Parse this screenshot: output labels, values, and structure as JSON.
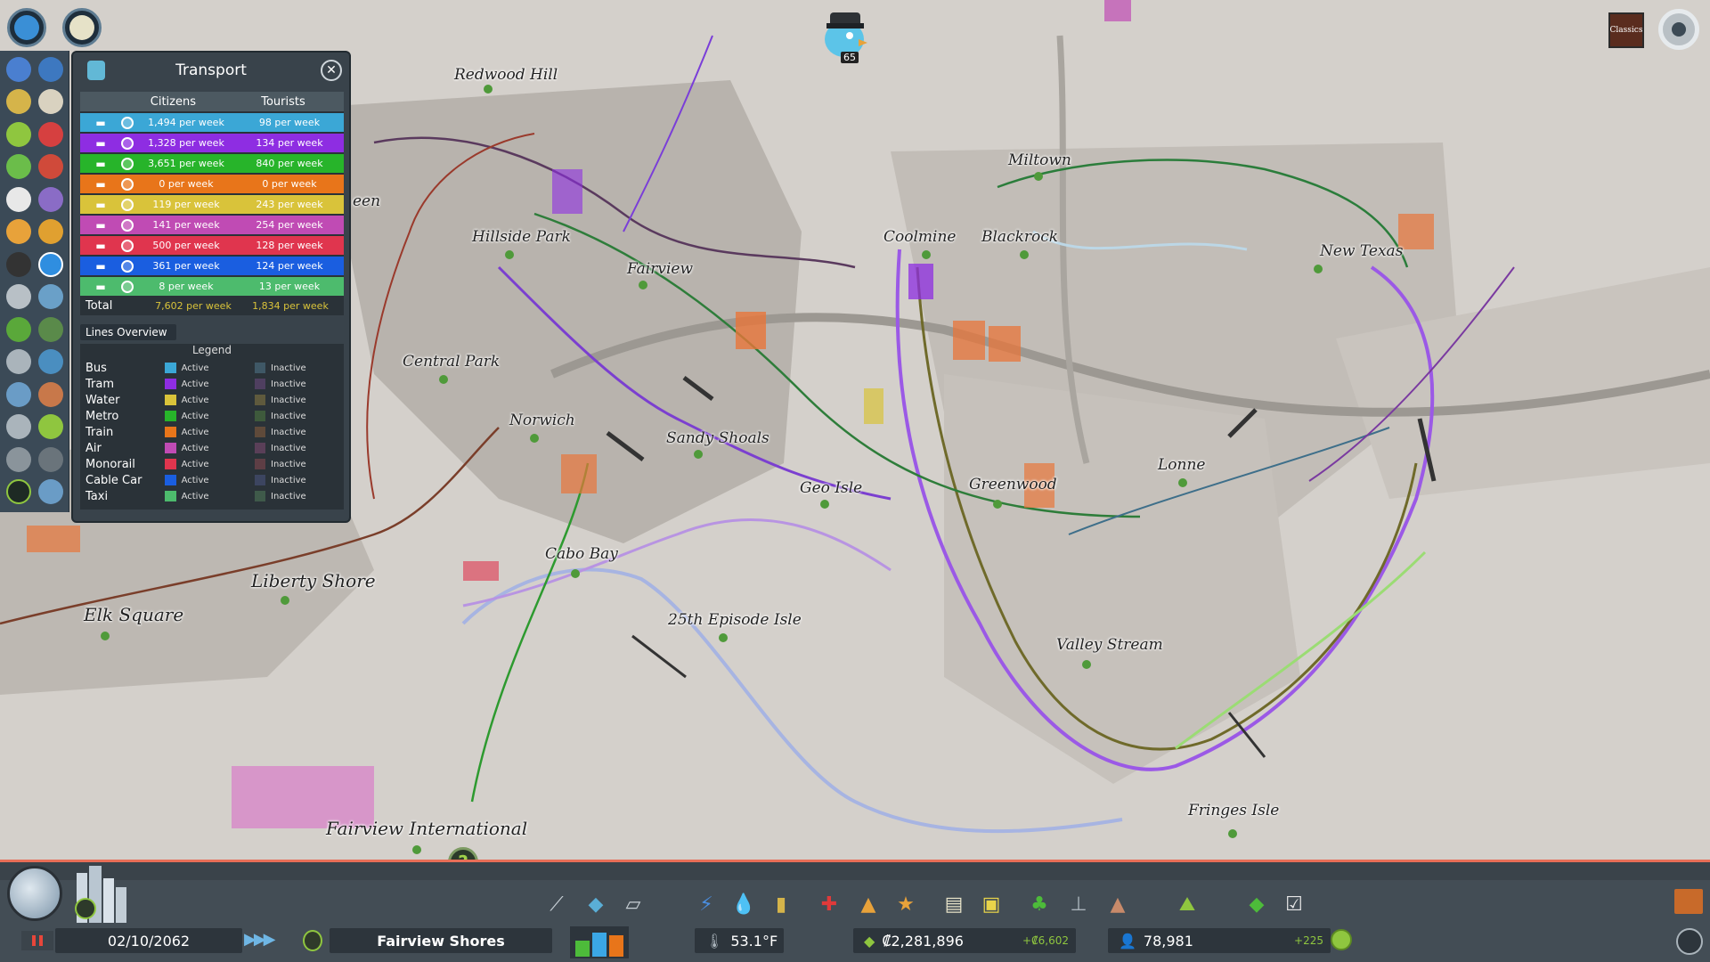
{
  "colors": {
    "bus": "#3ba7d6",
    "tram": "#8e2de2",
    "water": "#d9c33a",
    "metro": "#27b42a",
    "train": "#e8751a",
    "air": "#c04bb4",
    "monorail": "#e0354e",
    "cablecar": "#1a5ee0",
    "taxi": "#4dbb6d"
  },
  "top_buttons": {
    "left_icon": "compass-button-icon",
    "right_icon": "unlock-icon"
  },
  "chirper": {
    "count": "65"
  },
  "radio": {
    "label": "Classics"
  },
  "transport_panel": {
    "title": "Transport",
    "col_citizens": "Citizens",
    "col_tourists": "Tourists",
    "rows": [
      {
        "mode": "bus",
        "icon": "bus-icon",
        "citizens": "1,494 per week",
        "tourists": "98 per week"
      },
      {
        "mode": "tram",
        "icon": "tram-icon",
        "citizens": "1,328 per week",
        "tourists": "134 per week"
      },
      {
        "mode": "metro",
        "icon": "metro-icon",
        "citizens": "3,651 per week",
        "tourists": "840 per week"
      },
      {
        "mode": "train",
        "icon": "train-icon",
        "citizens": "0 per week",
        "tourists": "0 per week"
      },
      {
        "mode": "ship",
        "icon": "ship-icon",
        "citizens": "119 per week",
        "tourists": "243 per week"
      },
      {
        "mode": "air",
        "icon": "plane-icon",
        "citizens": "141 per week",
        "tourists": "254 per week"
      },
      {
        "mode": "monorail",
        "icon": "monorail-icon",
        "citizens": "500 per week",
        "tourists": "128 per week"
      },
      {
        "mode": "cablecar",
        "icon": "cablecar-icon",
        "citizens": "361 per week",
        "tourists": "124 per week"
      },
      {
        "mode": "taxi",
        "icon": "taxi-icon",
        "citizens": "8 per week",
        "tourists": "13 per week"
      }
    ],
    "total_label": "Total",
    "total_citizens": "7,602 per week",
    "total_tourists": "1,834 per week",
    "lines_overview": "Lines Overview",
    "legend_title": "Legend",
    "legend": [
      {
        "name": "Bus",
        "active": "Active",
        "inactive": "Inactive",
        "active_color": "#3ba7d6",
        "inactive_color": "#3f5866"
      },
      {
        "name": "Tram",
        "active": "Active",
        "inactive": "Inactive",
        "active_color": "#8e2de2",
        "inactive_color": "#4f3f60"
      },
      {
        "name": "Water",
        "active": "Active",
        "inactive": "Inactive",
        "active_color": "#d9c33a",
        "inactive_color": "#5f5a3d"
      },
      {
        "name": "Metro",
        "active": "Active",
        "inactive": "Inactive",
        "active_color": "#27b42a",
        "inactive_color": "#3e5a3c"
      },
      {
        "name": "Train",
        "active": "Active",
        "inactive": "Inactive",
        "active_color": "#e8751a",
        "inactive_color": "#5f4a3a"
      },
      {
        "name": "Air",
        "active": "Active",
        "inactive": "Inactive",
        "active_color": "#c04bb4",
        "inactive_color": "#5a3f58"
      },
      {
        "name": "Monorail",
        "active": "Active",
        "inactive": "Inactive",
        "active_color": "#e0354e",
        "inactive_color": "#5e3e45"
      },
      {
        "name": "Cable Car",
        "active": "Active",
        "inactive": "Inactive",
        "active_color": "#1a5ee0",
        "inactive_color": "#3c4560"
      },
      {
        "name": "Taxi",
        "active": "Active",
        "inactive": "Inactive",
        "active_color": "#4dbb6d",
        "inactive_color": "#3f5a4a"
      }
    ]
  },
  "map_labels": {
    "redwood_hill": "Redwood Hill",
    "hillside_park": "Hillside Park",
    "fairview": "Fairview",
    "central_park": "Central Park",
    "norwich": "Norwich",
    "sandy_shoals": "Sandy Shoals",
    "geo_isle": "Geo Isle",
    "cabo_bay": "Cabo Bay",
    "liberty_shore": "Liberty Shore",
    "elk_square": "Elk Square",
    "episode_isle": "25th Episode Isle",
    "fairview_international": "Fairview International",
    "miltown": "Miltown",
    "coolmine": "Coolmine",
    "blackrock": "Blackrock",
    "new_texas": "New Texas",
    "lonne": "Lonne",
    "greenwood": "Greenwood",
    "valley_stream": "Valley Stream",
    "fringes_isle": "Fringes Isle",
    "green_partial": "een"
  },
  "bottom": {
    "date": "02/10/2062",
    "speed": "▶▶▶",
    "city_name": "Fairview Shores",
    "temperature": "53.1°F",
    "money": "₡2,281,896",
    "money_delta": "+₡6,602",
    "population": "78,981",
    "population_delta": "+225",
    "zone_colors": {
      "residential": "#4dbb3a",
      "commercial": "#3ba7e6",
      "industrial": "#e8751a"
    },
    "zone_levels": {
      "residential": 0.55,
      "commercial": 0.85,
      "industrial": 0.75
    }
  },
  "toolbar": [
    "roads-icon",
    "zoning-icon",
    "districts-icon",
    "electricity-icon",
    "water-icon",
    "garbage-icon",
    "healthcare-icon",
    "fire-icon",
    "police-icon",
    "education-icon",
    "transport-icon",
    "parks-icon",
    "unique-buildings-icon",
    "monuments-icon",
    "landscaping-icon",
    "money-icon",
    "policies-icon"
  ]
}
